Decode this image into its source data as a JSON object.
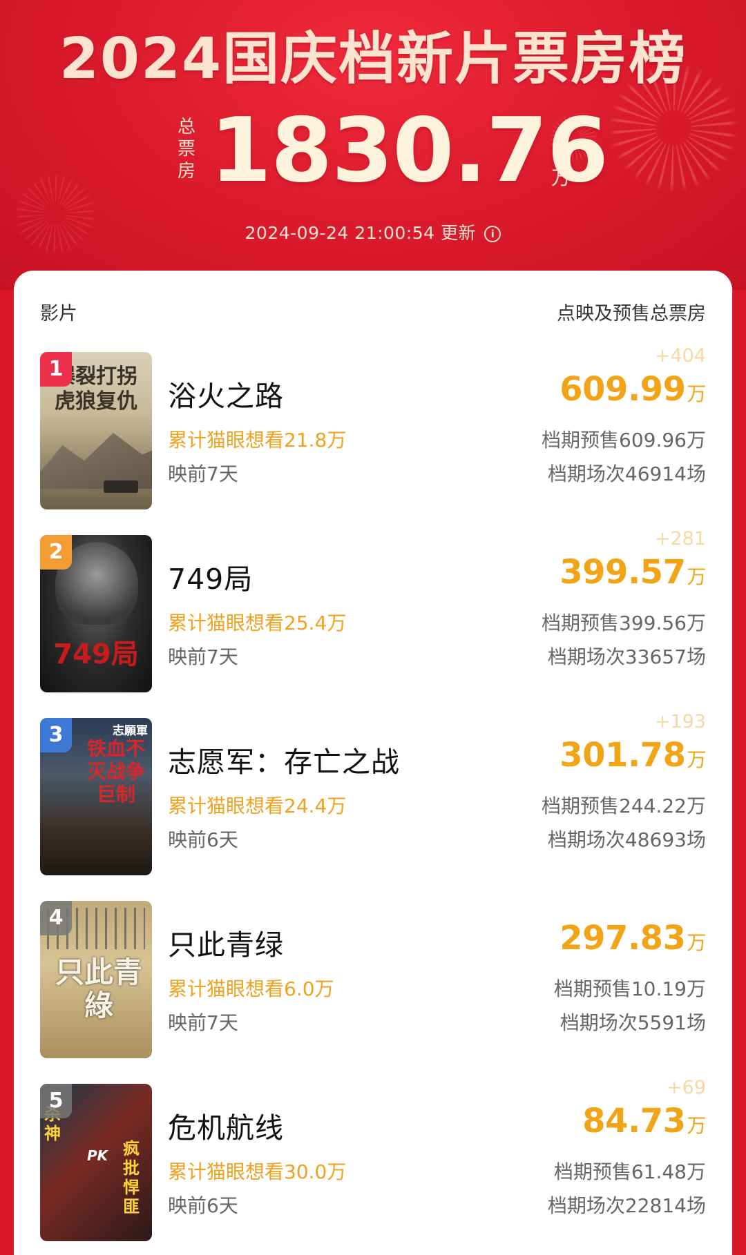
{
  "header": {
    "title": "2024国庆档新片票房榜",
    "total_label": "总票房",
    "total_value": "1830.76",
    "total_unit": "万",
    "updated_time": "2024-09-24  21:00:54",
    "updated_label": "更新",
    "info_icon": "i"
  },
  "table": {
    "col_left": "影片",
    "col_right": "点映及预售总票房"
  },
  "movies": [
    {
      "rank": "1",
      "title": "浴火之路",
      "want": "累计猫眼想看21.8万",
      "days": "映前7天",
      "delta": "+404",
      "box": "609.99",
      "unit": "万",
      "presale": "档期预售609.96万",
      "shows": "档期场次46914场",
      "poster_text": "爆裂打拐虎狼复仇"
    },
    {
      "rank": "2",
      "title": "749局",
      "want": "累计猫眼想看25.4万",
      "days": "映前7天",
      "delta": "+281",
      "box": "399.57",
      "unit": "万",
      "presale": "档期预售399.56万",
      "shows": "档期场次33657场",
      "poster_text": "749局"
    },
    {
      "rank": "3",
      "title": "志愿军：存亡之战",
      "want": "累计猫眼想看24.4万",
      "days": "映前6天",
      "delta": "+193",
      "box": "301.78",
      "unit": "万",
      "presale": "档期预售244.22万",
      "shows": "档期场次48693场",
      "poster_text": "铁血不灭战争巨制",
      "poster_brand": "志願軍"
    },
    {
      "rank": "4",
      "title": "只此青绿",
      "want": "累计猫眼想看6.0万",
      "days": "映前7天",
      "delta": "",
      "box": "297.83",
      "unit": "万",
      "presale": "档期预售10.19万",
      "shows": "档期场次5591场",
      "poster_text": "只此青綠"
    },
    {
      "rank": "5",
      "title": "危机航线",
      "want": "累计猫眼想看30.0万",
      "days": "映前6天",
      "delta": "+69",
      "box": "84.73",
      "unit": "万",
      "presale": "档期预售61.48万",
      "shows": "档期场次22814场",
      "poster_text_left": "杀神",
      "poster_text_right": "疯批悍匪",
      "poster_pk": "PK"
    }
  ],
  "colors": {
    "header_red": "#d9182a",
    "box_orange": "#f2a417",
    "want_orange": "#f0a21e"
  }
}
